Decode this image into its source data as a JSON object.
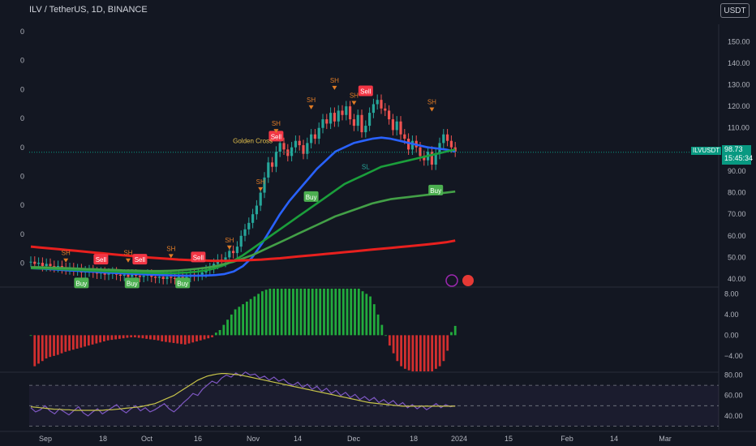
{
  "header": {
    "title": "ILV / TetherUS, 1D, BINANCE",
    "currency_button": "USDT"
  },
  "last_price": {
    "symbol": "ILVUSDT",
    "price": "98.73",
    "countdown": "15:45:34",
    "color": "#089981"
  },
  "left_scale_labels": [
    "0",
    "0",
    "0",
    "0",
    "0",
    "0",
    "0",
    "0",
    "0"
  ],
  "icons": [
    "lightning-icon",
    "us-flag-icon",
    "chart-logo-icon"
  ],
  "chart_data": [
    {
      "type": "line",
      "panel": "price",
      "y_ticks": [
        "150.00",
        "140.00",
        "130.00",
        "120.00",
        "110.00",
        "100.00",
        "90.00",
        "80.00",
        "70.00",
        "60.00",
        "50.00",
        "40.00"
      ],
      "ylim": [
        37,
        155
      ],
      "x_ticks": [
        "Sep",
        "18",
        "Oct",
        "16",
        "Nov",
        "14",
        "Dec",
        "18",
        "2024",
        "15",
        "Feb",
        "14",
        "Mar"
      ],
      "candles_close": [
        48,
        47,
        47.5,
        46,
        47,
        46,
        45.5,
        46,
        45,
        44.5,
        45,
        44,
        44.5,
        43,
        43.5,
        44,
        43,
        42.5,
        43,
        42,
        42.5,
        43,
        42,
        41.5,
        42,
        41,
        42,
        41.5,
        41,
        41.5,
        42,
        41,
        40.5,
        41,
        40,
        41,
        40.5,
        40,
        41,
        40.5,
        41,
        42,
        41.5,
        42,
        43,
        44,
        45,
        47,
        49,
        48,
        50,
        53,
        52,
        55,
        60,
        63,
        66,
        70,
        74,
        80,
        87,
        94,
        92,
        99,
        103,
        100,
        97,
        101,
        104,
        102,
        98,
        103,
        107,
        105,
        110,
        114,
        112,
        117,
        113,
        118,
        116,
        120,
        114,
        111,
        116,
        108,
        111,
        117,
        121,
        123,
        119,
        118,
        114,
        109,
        113,
        107,
        105,
        100,
        104,
        101,
        97,
        95,
        99,
        93,
        98,
        103,
        107,
        104,
        101,
        99
      ],
      "series": [
        {
          "name": "EMA blue",
          "color": "#2962ff",
          "values": [
            45,
            44.8,
            44.6,
            44.3,
            44,
            43.8,
            43.5,
            43.3,
            43,
            42.8,
            42.6,
            42.4,
            42.2,
            42,
            41.8,
            41.7,
            41.6,
            41.5,
            41.5,
            41.6,
            41.8,
            42.3,
            43.5,
            46,
            50,
            56,
            63,
            70,
            76,
            81,
            86,
            91,
            95,
            99,
            101,
            103,
            104,
            105,
            105.5,
            105,
            104,
            103,
            102,
            101,
            100.5,
            100,
            99
          ]
        },
        {
          "name": "EMA green",
          "color": "#1b9e3b",
          "values": [
            45,
            44.9,
            44.8,
            44.6,
            44.4,
            44.2,
            44,
            43.8,
            43.6,
            43.4,
            43.2,
            43,
            42.9,
            42.8,
            42.7,
            42.7,
            42.8,
            43,
            43.4,
            44,
            45,
            46.5,
            48.5,
            51,
            54,
            57,
            60,
            63,
            66,
            69,
            72,
            75,
            78,
            81,
            84,
            86,
            88,
            90,
            92,
            93,
            94,
            95,
            96,
            97,
            98,
            99,
            100
          ]
        },
        {
          "name": "SMA light green",
          "color": "#43a047",
          "values": [
            45.5,
            45.4,
            45.3,
            45.1,
            45,
            44.8,
            44.6,
            44.5,
            44.3,
            44.2,
            44,
            43.9,
            43.8,
            43.7,
            43.7,
            43.8,
            44,
            44.3,
            44.7,
            45.2,
            46,
            47,
            48,
            49.5,
            51,
            53,
            55,
            57,
            59,
            61,
            63,
            65,
            67,
            69,
            70.5,
            72,
            73.5,
            75,
            76,
            77,
            77.5,
            78,
            78.5,
            79,
            79.5,
            80,
            80.5
          ]
        },
        {
          "name": "SMA red",
          "color": "#e8201e",
          "values": [
            55,
            54.6,
            54.2,
            53.8,
            53.4,
            53,
            52.6,
            52.2,
            51.8,
            51.4,
            51,
            50.6,
            50.2,
            49.9,
            49.6,
            49.3,
            49,
            48.8,
            48.6,
            48.5,
            48.4,
            48.4,
            48.5,
            48.6,
            48.8,
            49,
            49.3,
            49.6,
            50,
            50.4,
            50.8,
            51.2,
            51.6,
            52,
            52.4,
            52.8,
            53.2,
            53.6,
            54,
            54.4,
            54.8,
            55.2,
            55.6,
            56,
            56.5,
            57,
            57.8
          ]
        }
      ],
      "signals": [
        {
          "label": "Sell",
          "type": "sell",
          "x_index": 18,
          "value": 49
        },
        {
          "label": "Sell",
          "type": "sell",
          "x_index": 28,
          "value": 49
        },
        {
          "label": "Sell",
          "type": "sell",
          "x_index": 43,
          "value": 50
        },
        {
          "label": "Sell",
          "type": "sell",
          "x_index": 63,
          "value": 106
        },
        {
          "label": "Sell",
          "type": "sell",
          "x_index": 86,
          "value": 127
        },
        {
          "label": "Buy",
          "type": "buy",
          "x_index": 13,
          "value": 38
        },
        {
          "label": "Buy",
          "type": "buy",
          "x_index": 26,
          "value": 38
        },
        {
          "label": "Buy",
          "type": "buy",
          "x_index": 39,
          "value": 38
        },
        {
          "label": "Buy",
          "type": "buy",
          "x_index": 72,
          "value": 78
        },
        {
          "label": "Buy",
          "type": "buy",
          "x_index": 104,
          "value": 81
        }
      ],
      "annotations": [
        {
          "label": "SH",
          "x_index": 9,
          "value": 51
        },
        {
          "label": "SH",
          "x_index": 25,
          "value": 51
        },
        {
          "label": "SH",
          "x_index": 36,
          "value": 53
        },
        {
          "label": "SH",
          "x_index": 51,
          "value": 57
        },
        {
          "label": "SH",
          "x_index": 59,
          "value": 84
        },
        {
          "label": "SH",
          "x_index": 63,
          "value": 111
        },
        {
          "label": "SH",
          "x_index": 72,
          "value": 122
        },
        {
          "label": "SH",
          "x_index": 78,
          "value": 131
        },
        {
          "label": "SH",
          "x_index": 83,
          "value": 124
        },
        {
          "label": "SH",
          "x_index": 103,
          "value": 121
        },
        {
          "label": "SL",
          "x_index": 86,
          "value": 91
        },
        {
          "label": "Golden Cross",
          "x_index": 57,
          "value": 103
        }
      ]
    },
    {
      "type": "bar",
      "panel": "momentum",
      "y_ticks": [
        "8.00",
        "4.00",
        "0.00",
        "−4.00"
      ],
      "ylim": [
        -7,
        9
      ],
      "colors": {
        "positive": "#22ab3d",
        "negative": "#d32f2f"
      },
      "values": [
        0,
        -6,
        -5.5,
        -5,
        -4.5,
        -4.2,
        -4,
        -3.8,
        -3.5,
        -3.2,
        -3,
        -2.8,
        -2.6,
        -2.4,
        -2.2,
        -2,
        -1.8,
        -1.6,
        -1.4,
        -1.2,
        -1,
        -0.9,
        -0.8,
        -0.7,
        -0.6,
        -0.5,
        -0.4,
        -0.4,
        -0.5,
        -0.6,
        -0.7,
        -0.8,
        -0.9,
        -1,
        -1.2,
        -1.3,
        -1.4,
        -1.5,
        -1.6,
        -1.7,
        -1.8,
        -1.6,
        -1.4,
        -1.2,
        -1,
        -0.8,
        -0.6,
        -0.4,
        0.5,
        1,
        2,
        3,
        4,
        5,
        5.5,
        6,
        6.5,
        7,
        7.5,
        8,
        8.5,
        8.8,
        9,
        9,
        9,
        9,
        9,
        9,
        9,
        9,
        9,
        9,
        9,
        9,
        9,
        9,
        9,
        9,
        9,
        9,
        9,
        9,
        9,
        9,
        9,
        9,
        8.5,
        8,
        7.5,
        6,
        4,
        2,
        0,
        -2,
        -3.5,
        -5,
        -6,
        -6.5,
        -6.8,
        -7,
        -7,
        -7,
        -7,
        -7,
        -7,
        -6.5,
        -6,
        -5,
        -3,
        0.6,
        1.8
      ]
    },
    {
      "type": "line",
      "panel": "rsi",
      "y_ticks": [
        "80.00",
        "60.00",
        "40.00"
      ],
      "ylim": [
        28,
        82
      ],
      "bands": [
        70,
        50,
        30
      ],
      "series": [
        {
          "name": "RSI",
          "color": "#7e57c2",
          "values": [
            48,
            44,
            46,
            50,
            45,
            42,
            47,
            44,
            41,
            45,
            49,
            43,
            40,
            44,
            47,
            42,
            45,
            48,
            51,
            46,
            43,
            47,
            50,
            45,
            48,
            44,
            46,
            49,
            52,
            47,
            44,
            48,
            53,
            57,
            62,
            60,
            66,
            70,
            74,
            72,
            77,
            80,
            78,
            82,
            79,
            83,
            80,
            81,
            77,
            79,
            75,
            78,
            74,
            76,
            72,
            70,
            73,
            68,
            71,
            66,
            69,
            64,
            67,
            62,
            65,
            60,
            63,
            58,
            61,
            56,
            59,
            55,
            58,
            53,
            56,
            52,
            55,
            50,
            53,
            48,
            51,
            47,
            50,
            46,
            49,
            52,
            48,
            51,
            49,
            50
          ]
        },
        {
          "name": "RSI MA",
          "color": "#c8c44a",
          "values": [
            49,
            48.5,
            48,
            47.5,
            47,
            46.5,
            46.5,
            46,
            46,
            45.5,
            45.5,
            45.5,
            45.5,
            45.5,
            45.5,
            45.5,
            46,
            46,
            46.5,
            47,
            47.5,
            48,
            48.5,
            49,
            50,
            51,
            52,
            54,
            56,
            58,
            60,
            63,
            66,
            69,
            72,
            75,
            77,
            79,
            80,
            81,
            81.5,
            81.5,
            81,
            80.5,
            80,
            79,
            78,
            77,
            76,
            75,
            74,
            73,
            72,
            71,
            70,
            69,
            68,
            67,
            66,
            65,
            64,
            63,
            62,
            61,
            60,
            59,
            58,
            57,
            56,
            55,
            54,
            53,
            52.5,
            52,
            51.5,
            51,
            50.5,
            50,
            49.5,
            49.5,
            49.5,
            49.5,
            49.5,
            49.5,
            49.5,
            49.5,
            49.5,
            49.5,
            49.5,
            49.5
          ]
        }
      ]
    }
  ]
}
